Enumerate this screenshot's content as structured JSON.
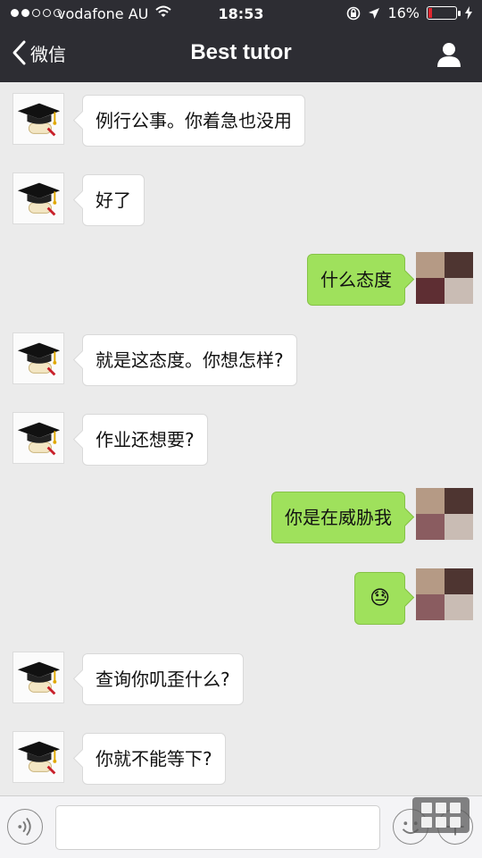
{
  "status_bar": {
    "carrier": "vodafone AU",
    "time": "18:53",
    "battery_text": "16%",
    "signal_bars_filled": 2,
    "signal_bars_total": 5,
    "battery_level": 0.16
  },
  "nav": {
    "back_label": "微信",
    "title": "Best tutor",
    "icons": {
      "back": "chevron-left-icon",
      "profile": "person-icon"
    }
  },
  "messages": [
    {
      "sender": "tutor",
      "text": "例行公事。你着急也没用"
    },
    {
      "sender": "tutor",
      "text": "好了"
    },
    {
      "sender": "me",
      "text": "什么态度"
    },
    {
      "sender": "tutor",
      "text": "就是这态度。你想怎样?"
    },
    {
      "sender": "tutor",
      "text": "作业还想要?"
    },
    {
      "sender": "me",
      "text": "你是在威胁我"
    },
    {
      "sender": "me",
      "text": "😓",
      "kind": "emoji"
    },
    {
      "sender": "tutor",
      "text": "查询你叽歪什么?"
    },
    {
      "sender": "tutor",
      "text": "你就不能等下?"
    }
  ],
  "input_bar": {
    "text_value": "",
    "icons": {
      "voice": "voice-icon",
      "emoji": "smiley-icon",
      "more": "plus-icon",
      "keypad": "keypad-icon"
    }
  },
  "colors": {
    "nav_bg": "#2d2d33",
    "chat_bg": "#ebebeb",
    "outgoing_bubble": "#9fe15c",
    "incoming_bubble": "#ffffff",
    "battery_low": "#e0262f"
  }
}
